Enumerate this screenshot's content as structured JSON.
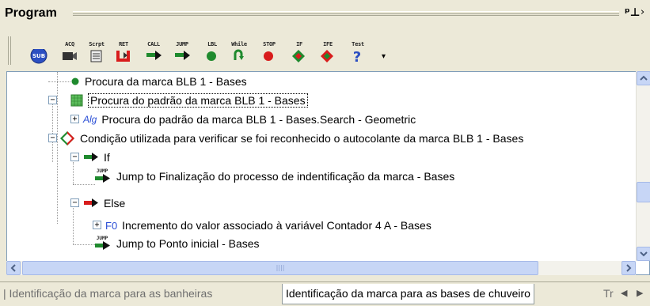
{
  "panel": {
    "title": "Program",
    "pin_icon": "pin-icon",
    "more_icon": "chevron-right-icon"
  },
  "toolbar": {
    "items": [
      {
        "label": "SUB",
        "icon": "sub-icon"
      },
      {
        "label": "ACQ",
        "icon": "camera-icon"
      },
      {
        "label": "Scrpt",
        "icon": "script-icon"
      },
      {
        "label": "RET",
        "icon": "return-icon"
      },
      {
        "label": "CALL",
        "icon": "call-arrow-icon"
      },
      {
        "label": "JUMP",
        "icon": "jump-arrow-icon"
      },
      {
        "label": "LBL",
        "icon": "label-dot-icon"
      },
      {
        "label": "While",
        "icon": "while-loop-icon"
      },
      {
        "label": "STOP",
        "icon": "stop-icon"
      },
      {
        "label": "IF",
        "icon": "if-diamond-icon"
      },
      {
        "label": "IFE",
        "icon": "ife-diamond-icon"
      },
      {
        "label": "Test",
        "icon": "test-question-icon"
      }
    ],
    "overflow_icon": "dropdown-arrow-icon"
  },
  "tree": {
    "nodes": [
      {
        "text": "Procura da marca BLB 1 - Bases",
        "icon": "label-dot-icon"
      },
      {
        "text": "Procura do padrão da marca BLB 1 - Bases",
        "icon": "pattern-icon",
        "selected": true
      },
      {
        "prefix": "Alg",
        "text": "Procura do padrão da marca BLB 1 - Bases.Search - Geometric",
        "icon": "algorithm-icon"
      },
      {
        "text": "Condição utilizada para verificar se foi reconhecido o autocolante da marca BLB 1 - Bases",
        "icon": "if-else-diamond-icon"
      },
      {
        "text": "If",
        "icon": "if-arrow-icon"
      },
      {
        "text": "Jump to Finalização do processo de indentificação da marca - Bases",
        "icon": "jump-icon",
        "badge": "JUMP"
      },
      {
        "text": "Else",
        "icon": "else-arrow-icon"
      },
      {
        "prefix": "F0",
        "text": "Incremento do valor associado à variável Contador 4 A - Bases",
        "icon": "function-icon"
      },
      {
        "text": "Jump to Ponto inicial - Bases",
        "icon": "jump-icon",
        "badge": "JUMP"
      }
    ]
  },
  "tabs": [
    {
      "label": "| Identificação da marca para as banheiras",
      "active": false
    },
    {
      "label": "Identificação da marca para as bases de chuveiro",
      "active": true
    },
    {
      "label": "Tr",
      "active": false
    }
  ],
  "colors": {
    "background": "#ece9d8",
    "scroll_blue": "#c7d6f6",
    "green": "#1f8a2e",
    "red": "#d81c1c",
    "algo_blue": "#2b4fd6"
  }
}
